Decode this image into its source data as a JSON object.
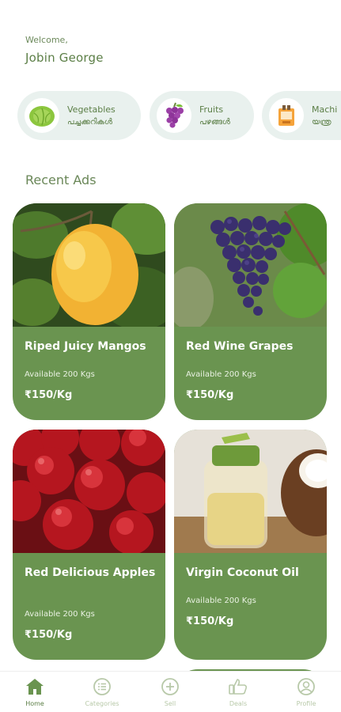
{
  "header": {
    "welcome_label": "Welcome,",
    "user_name": "Jobin George"
  },
  "categories": [
    {
      "label": "Vegetables",
      "label_ml": "പച്ചക്കറികൾ",
      "icon": "cabbage-icon"
    },
    {
      "label": "Fruits",
      "label_ml": "പഴങ്ങൾ",
      "icon": "grapes-icon"
    },
    {
      "label": "Machi",
      "label_ml": "യന്ത്ര",
      "icon": "machinery-icon"
    }
  ],
  "section": {
    "title": "Recent Ads"
  },
  "ads": [
    {
      "title": "Riped Juicy Mangos",
      "availability": "Available 200 Kgs",
      "price": "₹150/Kg",
      "image": "mango"
    },
    {
      "title": "Red Wine Grapes",
      "availability": "Available 200 Kgs",
      "price": "₹150/Kg",
      "image": "grapes"
    },
    {
      "title": "Red Delicious Apples",
      "availability": "Available 200 Kgs",
      "price": "₹150/Kg",
      "image": "apples"
    },
    {
      "title": "Virgin Coconut Oil",
      "availability": "Available 200 Kgs",
      "price": "₹150/Kg",
      "image": "coconut-oil"
    }
  ],
  "nav": {
    "items": [
      {
        "label": "Home",
        "icon": "home-icon",
        "active": true
      },
      {
        "label": "Categories",
        "icon": "list-icon",
        "active": false
      },
      {
        "label": "Sell",
        "icon": "plus-circle-icon",
        "active": false
      },
      {
        "label": "Deals",
        "icon": "thumbs-up-icon",
        "active": false
      },
      {
        "label": "Profile",
        "icon": "user-icon",
        "active": false
      }
    ]
  },
  "colors": {
    "primary": "#6a9450",
    "text_green": "#5c7f47",
    "chip_bg": "#e9f1ee",
    "nav_inactive": "#b8c9a9"
  }
}
